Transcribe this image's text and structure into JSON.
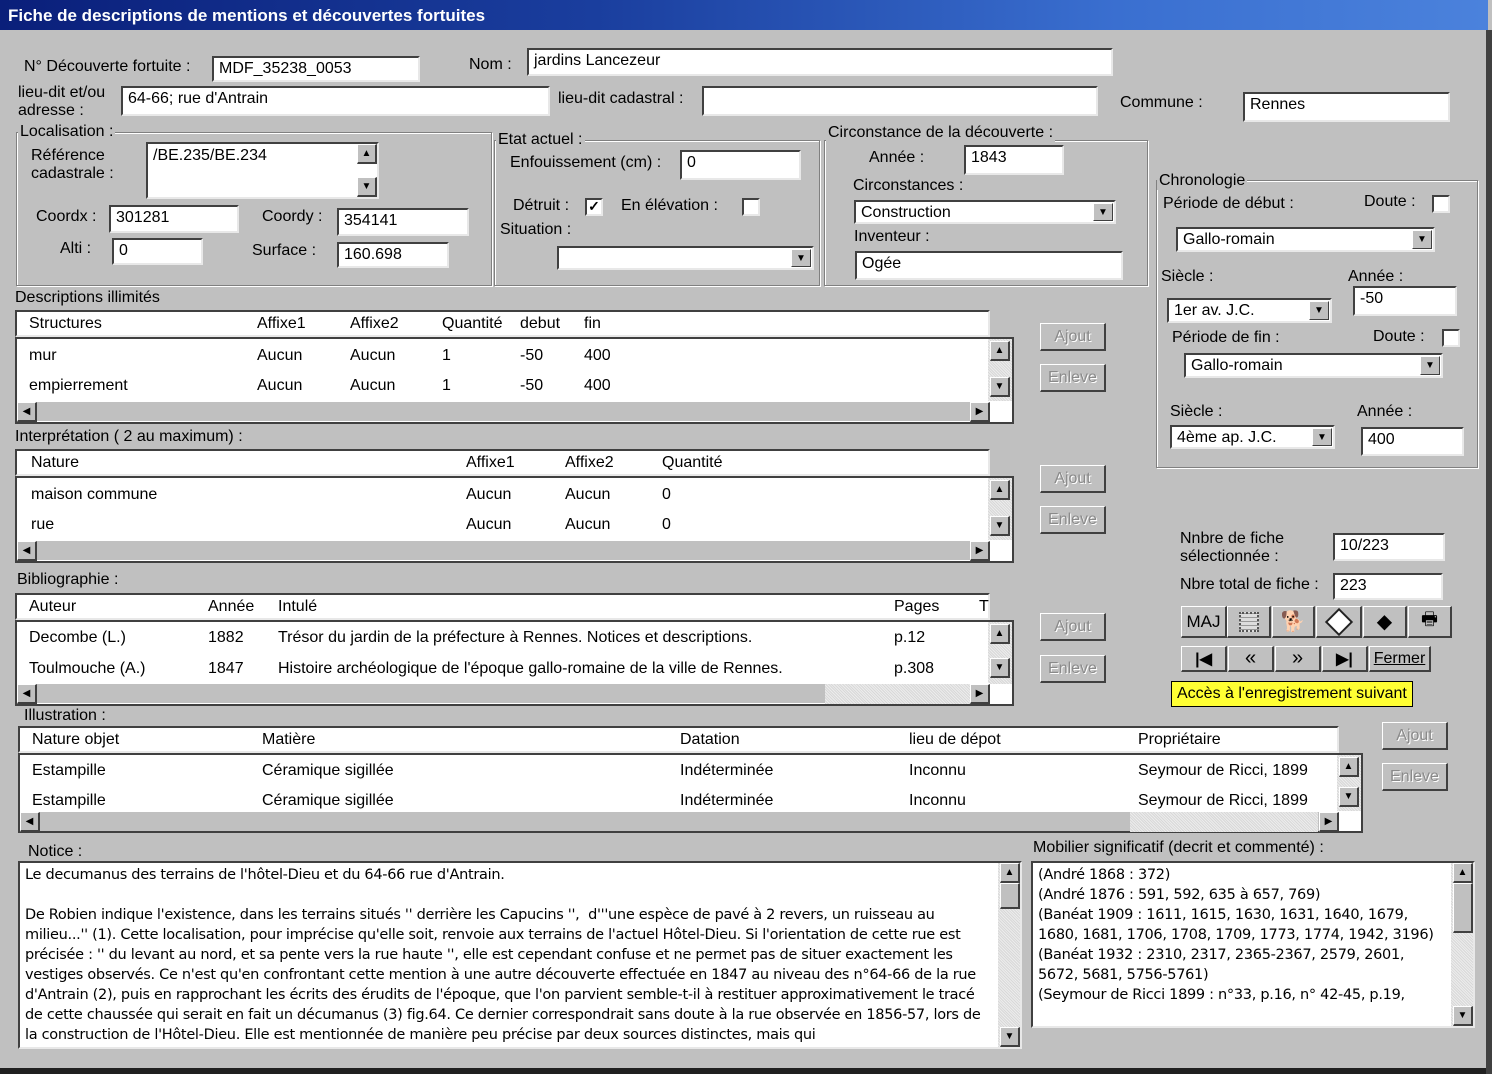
{
  "window": {
    "title": "Fiche de descriptions de mentions et découvertes fortuites"
  },
  "header": {
    "num_label": "N° Découverte fortuite :",
    "num_value": "MDF_35238_0053",
    "nom_label": "Nom :",
    "nom_value": "jardins Lancezeur",
    "lieudit_label": "lieu-dit et/ou adresse :",
    "lieudit_value": "64-66; rue d'Antrain",
    "cadastral_label": "lieu-dit cadastral :",
    "cadastral_value": "",
    "commune_label": "Commune :",
    "commune_value": "Rennes"
  },
  "localisation": {
    "title": "Localisation :",
    "ref_label": "Référence cadastrale :",
    "ref_value": "/BE.235/BE.234",
    "coordx_label": "Coordx :",
    "coordx_value": "301281",
    "coordy_label": "Coordy :",
    "coordy_value": "354141",
    "alti_label": "Alti :",
    "alti_value": "0",
    "surface_label": "Surface :",
    "surface_value": "160.698"
  },
  "etat": {
    "title": "Etat actuel :",
    "enfouissement_label": "Enfouissement (cm) :",
    "enfouissement_value": "0",
    "detruit_label": "Détruit :",
    "detruit_checked": true,
    "elevation_label": "En élévation :",
    "elevation_checked": false,
    "situation_label": "Situation :",
    "situation_value": ""
  },
  "circonstance": {
    "title": "Circonstance de la découverte :",
    "annee_label": "Année :",
    "annee_value": "1843",
    "circonstances_label": "Circonstances :",
    "circonstances_value": "Construction",
    "inventeur_label": "Inventeur :",
    "inventeur_value": "Ogée"
  },
  "chronologie": {
    "title": "Chronologie",
    "debut_label": "Période de début :",
    "doute_label": "Doute :",
    "debut_doute": false,
    "debut_value": "Gallo-romain",
    "siecle_label": "Siècle :",
    "annee_label": "Année :",
    "debut_siecle": "1er av. J.C.",
    "debut_annee": "-50",
    "fin_label": "Période de fin :",
    "fin_doute": false,
    "fin_value": "Gallo-romain",
    "fin_siecle": "4ème ap. J.C.",
    "fin_annee": "400"
  },
  "descriptions": {
    "title": "Descriptions illimités",
    "columns": [
      "Structures",
      "Affixe1",
      "Affixe2",
      "Quantité",
      "debut",
      "fin"
    ],
    "rows": [
      [
        "mur",
        "Aucun",
        "Aucun",
        "1",
        "-50",
        "400"
      ],
      [
        "empierrement",
        "Aucun",
        "Aucun",
        "1",
        "-50",
        "400"
      ]
    ]
  },
  "interpretation": {
    "title": "Interprétation ( 2 au maximum) :",
    "columns": [
      "Nature",
      "Affixe1",
      "Affixe2",
      "Quantité"
    ],
    "rows": [
      [
        "maison commune",
        "Aucun",
        "Aucun",
        "0"
      ],
      [
        "rue",
        "Aucun",
        "Aucun",
        "0"
      ]
    ]
  },
  "bibliographie": {
    "title": "Bibliographie :",
    "columns": [
      "Auteur",
      "Année",
      "Intulé",
      "Pages",
      "T"
    ],
    "rows": [
      [
        "Decombe (L.)",
        "1882",
        "Trésor du jardin de la préfecture à Rennes. Notices et descriptions.",
        "p.12"
      ],
      [
        "Toulmouche (A.)",
        "1847",
        "Histoire archéologique de l'époque gallo-romaine de la ville de Rennes.",
        "p.308"
      ]
    ]
  },
  "illustration": {
    "title": "Illustration :",
    "columns": [
      "Nature objet",
      "Matière",
      "Datation",
      "lieu de dépot",
      "Propriétaire"
    ],
    "rows": [
      [
        "Estampille",
        "Céramique sigillée",
        "Indéterminée",
        "Inconnu",
        "Seymour de Ricci, 1899"
      ],
      [
        "Estampille",
        "Céramique sigillée",
        "Indéterminée",
        "Inconnu",
        "Seymour de Ricci, 1899"
      ]
    ]
  },
  "buttons": {
    "ajout": "Ajout",
    "enleve": "Enleve"
  },
  "counts": {
    "selected_label": "Nnbre de fiche sélectionnée :",
    "selected_value": "10/223",
    "total_label": "Nbre total de fiche :",
    "total_value": "223"
  },
  "toolbar": {
    "maj": "MAJ",
    "icons": [
      "grid-icon",
      "search-dog-icon",
      "disk-arrow-icon",
      "diamond-icon",
      "printer-icon"
    ],
    "first": "first-record-icon",
    "prev": "«",
    "next": "»",
    "last": "last-record-icon",
    "fermer": "Fermer"
  },
  "tooltip": "Accès à l'enregistrement suivant",
  "notice": {
    "label": "Notice :",
    "text": "Le decumanus des terrains de l'hôtel-Dieu et du 64-66 rue d'Antrain.\n\nDe Robien indique l'existence, dans les terrains situés '' derrière les Capucins '',  d'''une espèce de pavé à 2 revers, un ruisseau au milieu...'' (1). Cette localisation, pour imprécise qu'elle soit, renvoie aux terrains de l'actuel Hôtel-Dieu. Si l'orientation de cette rue est précisée : '' du levant au nord, et sa pente vers la rue haute '', elle est cependant confuse et ne permet pas de situer exactement les vestiges observés. Ce n'est qu'en confrontant cette mention à une autre découverte effectuée en 1847 au niveau des n°64-66 de la rue d'Antrain (2), puis en rapprochant les écrits des érudits de l'époque, que l'on parvient semble-t-il à restituer approximativement le tracé de cette chaussée qui serait en fait un décumanus (3) fig.64. Ce dernier correspondrait sans doute à la rue observée en 1856-57, lors de la construction de l'Hôtel-Dieu. Elle est mentionnée de manière peu précise par deux sources distinctes, mais qui"
  },
  "mobilier": {
    "label": "Mobilier  significatif (decrit et commenté) :",
    "text": "(André 1868 : 372)\n(André 1876 : 591, 592, 635 à 657, 769)\n(Banéat 1909 : 1611, 1615, 1630, 1631, 1640, 1679, 1680, 1681, 1706, 1708, 1709, 1773, 1774, 1942, 3196)\n(Banéat 1932 : 2310, 2317, 2365-2367, 2579, 2601, 5672, 5681, 5756-5761)\n(Seymour de Ricci 1899 : n°33, p.16, n° 42-45, p.19,"
  }
}
